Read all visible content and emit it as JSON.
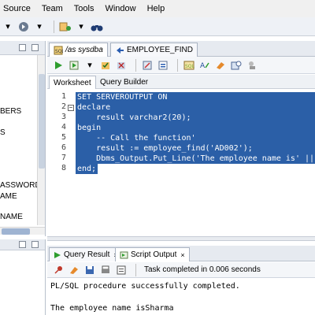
{
  "menu": [
    "Source",
    "Team",
    "Tools",
    "Window",
    "Help"
  ],
  "navigator": {
    "items": [
      "BERS",
      "S",
      "ASSWORD",
      "AME",
      "NAME"
    ]
  },
  "doc_tabs": [
    {
      "label": "/as sysdba",
      "icon": "sql-worksheet-icon",
      "active": true
    },
    {
      "label": "EMPLOYEE_FIND",
      "icon": "function-icon",
      "active": false
    }
  ],
  "sub_tabs": [
    "Worksheet",
    "Query Builder"
  ],
  "editor": {
    "line_numbers": [
      "1",
      "2",
      "3",
      "4",
      "5",
      "6",
      "7",
      "8"
    ],
    "lines": [
      "SET SERVEROUTPUT ON",
      "declare",
      "    result varchar2(20);",
      "begin",
      "    -- Call the function'",
      "    result := employee_find('AD002');",
      "    Dbms_Output.Put_Line('The employee name is' ||resul",
      "end;"
    ]
  },
  "output_tabs": [
    {
      "label": "Query Result",
      "close": "×",
      "active": false
    },
    {
      "label": "Script Output",
      "close": "×",
      "active": true
    }
  ],
  "output_status": "Task completed in 0.006 seconds",
  "output_lines": [
    "PL/SQL procedure successfully completed.",
    "The employee name isSharma"
  ],
  "colors": {
    "selection": "#2b5fa7",
    "run_green": "#2e9d2e"
  }
}
